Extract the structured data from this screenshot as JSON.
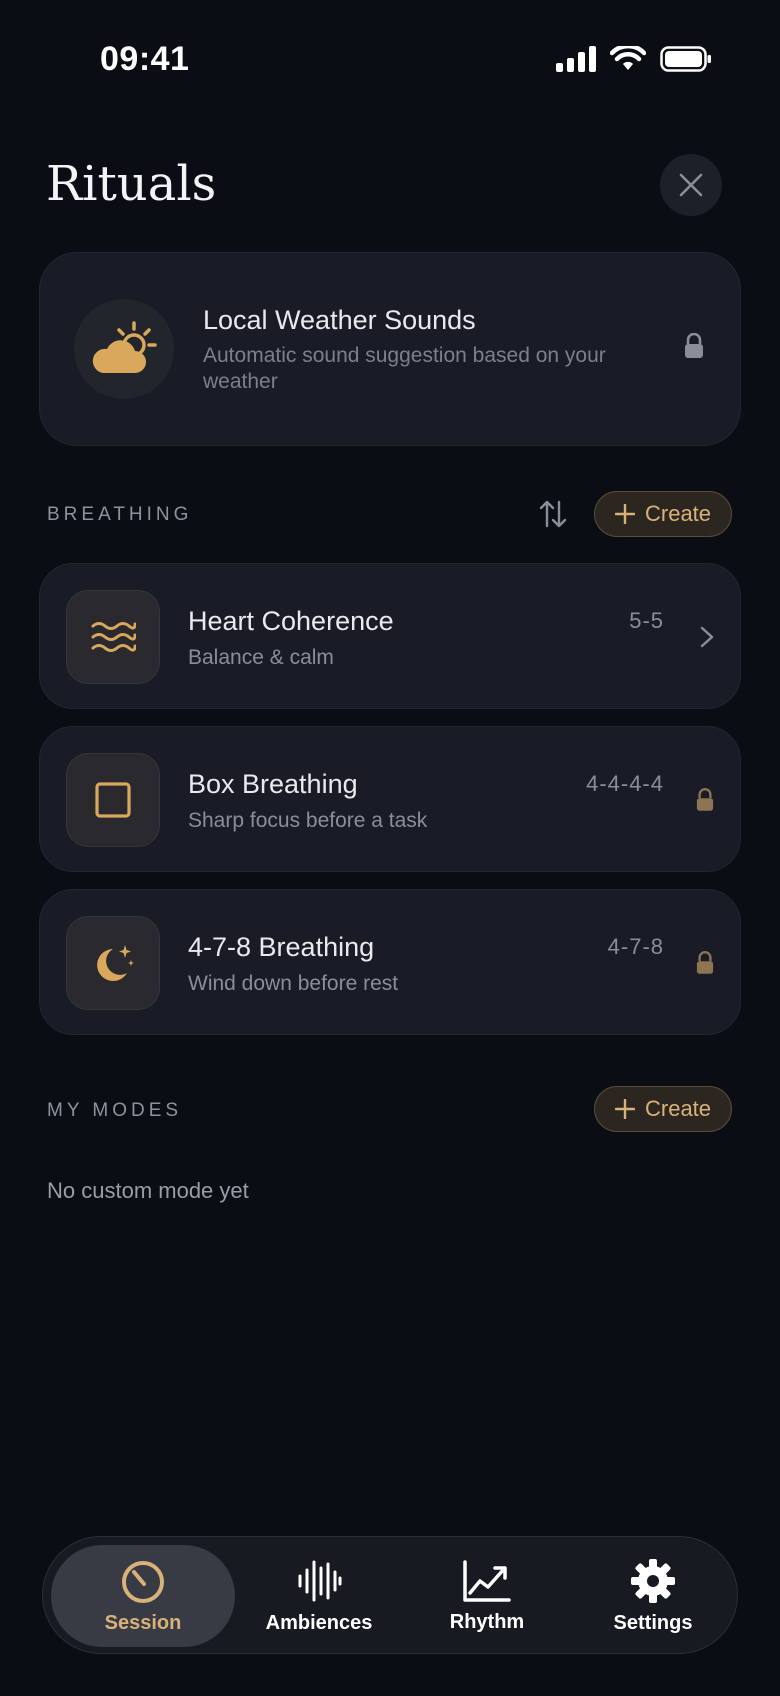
{
  "status": {
    "time": "09:41"
  },
  "header": {
    "title": "Rituals"
  },
  "weather": {
    "title": "Local Weather Sounds",
    "subtitle": "Automatic sound suggestion based on your weather"
  },
  "breathing": {
    "label": "BREATHING",
    "create_label": "Create",
    "items": [
      {
        "title": "Heart Coherence",
        "subtitle": "Balance & calm",
        "pattern": "5-5",
        "icon": "waves-icon",
        "locked": false
      },
      {
        "title": "Box Breathing",
        "subtitle": "Sharp focus before a task",
        "pattern": "4-4-4-4",
        "icon": "square-icon",
        "locked": true
      },
      {
        "title": "4-7-8 Breathing",
        "subtitle": "Wind down before rest",
        "pattern": "4-7-8",
        "icon": "moon-stars-icon",
        "locked": true
      }
    ]
  },
  "modes": {
    "label": "MY MODES",
    "create_label": "Create",
    "empty_text": "No custom mode yet"
  },
  "tabs": [
    {
      "label": "Session",
      "icon": "timer-icon",
      "active": true
    },
    {
      "label": "Ambiences",
      "icon": "soundwave-icon",
      "active": false
    },
    {
      "label": "Rhythm",
      "icon": "chart-icon",
      "active": false
    },
    {
      "label": "Settings",
      "icon": "gear-icon",
      "active": false
    }
  ],
  "colors": {
    "background": "#0b0d14",
    "card": "#191c26",
    "accent": "#d9b27a",
    "muted": "#8b8e98"
  }
}
